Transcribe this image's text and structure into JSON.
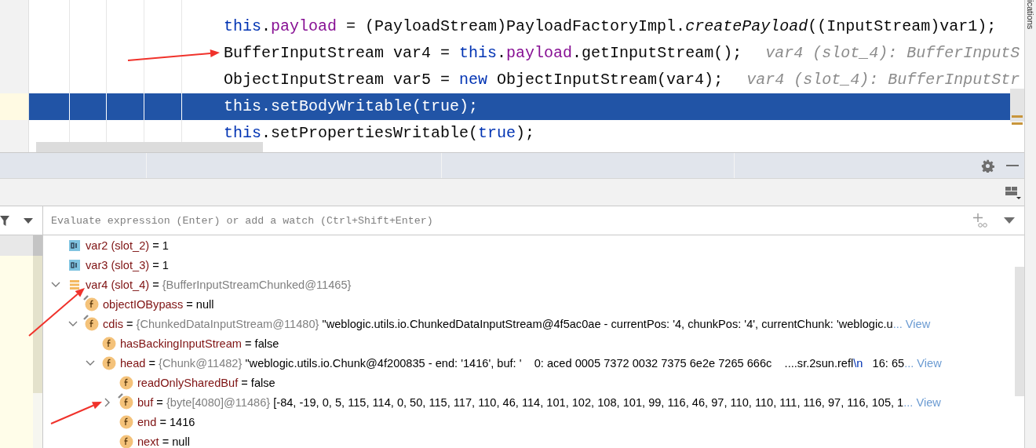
{
  "editor": {
    "lines": [
      {
        "current": false,
        "segments": [
          {
            "text": "this",
            "kind": "keyword"
          },
          {
            "text": ".",
            "kind": "plain"
          },
          {
            "text": "payload",
            "kind": "field"
          },
          {
            "text": " = (PayloadStream)PayloadFactoryImpl.",
            "kind": "plain"
          },
          {
            "text": "createPayload",
            "kind": "static"
          },
          {
            "text": "((InputStream)var1);",
            "kind": "plain"
          }
        ]
      },
      {
        "current": false,
        "segments": [
          {
            "text": "BufferInputStream var4 = ",
            "kind": "plain"
          },
          {
            "text": "this",
            "kind": "keyword"
          },
          {
            "text": ".",
            "kind": "plain"
          },
          {
            "text": "payload",
            "kind": "field"
          },
          {
            "text": ".getInputStream();",
            "kind": "plain"
          },
          {
            "text": "var4 (slot_4): BufferInputS",
            "kind": "hint"
          }
        ]
      },
      {
        "current": false,
        "segments": [
          {
            "text": "ObjectInputStream var5 = ",
            "kind": "plain"
          },
          {
            "text": "new",
            "kind": "keyword"
          },
          {
            "text": " ObjectInputStream(var4);",
            "kind": "plain"
          },
          {
            "text": "var4 (slot_4): BufferInputStr",
            "kind": "hint"
          }
        ]
      },
      {
        "current": true,
        "segments": [
          {
            "text": "this",
            "kind": "keyword"
          },
          {
            "text": ".setBodyWritable(",
            "kind": "plain"
          },
          {
            "text": "true",
            "kind": "keyword"
          },
          {
            "text": ");",
            "kind": "plain"
          }
        ]
      },
      {
        "current": false,
        "segments": [
          {
            "text": "this",
            "kind": "keyword"
          },
          {
            "text": ".setPropertiesWritable(",
            "kind": "plain"
          },
          {
            "text": "true",
            "kind": "keyword"
          },
          {
            "text": ");",
            "kind": "plain"
          }
        ]
      }
    ]
  },
  "side_strip": {
    "label": "ications"
  },
  "debugger": {
    "expression": {
      "placeholder": "Evaluate expression (Enter) or add a watch (Ctrl+Shift+Enter)"
    },
    "variables": [
      {
        "kind": "primitive",
        "badge": false,
        "segments": [
          {
            "text": "var2 (slot_2)",
            "kind": "name"
          },
          {
            "text": " = ",
            "kind": "plain"
          },
          {
            "text": "1",
            "kind": "plain"
          }
        ]
      },
      {
        "kind": "primitive",
        "badge": false,
        "segments": [
          {
            "text": "var3 (slot_3)",
            "kind": "name"
          },
          {
            "text": " = ",
            "kind": "plain"
          },
          {
            "text": "1",
            "kind": "plain"
          }
        ]
      },
      {
        "kind": "object",
        "badge": false,
        "expanded": true,
        "segments": [
          {
            "text": "var4 (slot_4)",
            "kind": "name"
          },
          {
            "text": " = ",
            "kind": "plain"
          },
          {
            "text": "{BufferInputStreamChunked@11465}",
            "kind": "type"
          }
        ],
        "children": [
          {
            "kind": "field",
            "badge": true,
            "segments": [
              {
                "text": "objectIOBypass",
                "kind": "name"
              },
              {
                "text": " = ",
                "kind": "plain"
              },
              {
                "text": "null",
                "kind": "plain"
              }
            ]
          },
          {
            "kind": "field",
            "badge": true,
            "expanded": true,
            "link": "... View",
            "segments": [
              {
                "text": "cdis",
                "kind": "name"
              },
              {
                "text": " = ",
                "kind": "plain"
              },
              {
                "text": "{ChunkedDataInputStream@11480}",
                "kind": "type"
              },
              {
                "text": " \"weblogic.utils.io.ChunkedDataInputStream@4f5ac0ae - currentPos: '4, chunkPos: '4', currentChunk: 'weblogic.u",
                "kind": "plain"
              }
            ],
            "children": [
              {
                "kind": "field",
                "badge": false,
                "segments": [
                  {
                    "text": "hasBackingInputStream",
                    "kind": "name"
                  },
                  {
                    "text": " = ",
                    "kind": "plain"
                  },
                  {
                    "text": "false",
                    "kind": "plain"
                  }
                ]
              },
              {
                "kind": "field",
                "badge": false,
                "expanded": true,
                "link": "... View",
                "segments": [
                  {
                    "text": "head",
                    "kind": "name"
                  },
                  {
                    "text": " = ",
                    "kind": "plain"
                  },
                  {
                    "text": "{Chunk@11482}",
                    "kind": "type"
                  },
                  {
                    "text": " \"weblogic.utils.io.Chunk@4f200835 - end: '1416', buf: '    0: aced 0005 7372 0032 7375 6e2e 7265 666c    ....sr.2sun.refl",
                    "kind": "plain"
                  },
                  {
                    "text": "\\n",
                    "kind": "escape"
                  },
                  {
                    "text": "   16: 65",
                    "kind": "plain"
                  }
                ],
                "children": [
                  {
                    "kind": "field",
                    "badge": false,
                    "segments": [
                      {
                        "text": "readOnlySharedBuf",
                        "kind": "name"
                      },
                      {
                        "text": " = ",
                        "kind": "plain"
                      },
                      {
                        "text": "false",
                        "kind": "plain"
                      }
                    ]
                  },
                  {
                    "kind": "field",
                    "badge": true,
                    "expanded": false,
                    "link": "... View",
                    "segments": [
                      {
                        "text": "buf",
                        "kind": "name"
                      },
                      {
                        "text": " = ",
                        "kind": "plain"
                      },
                      {
                        "text": "{byte[4080]@11486}",
                        "kind": "type"
                      },
                      {
                        "text": " [-84, -19, 0, 5, 115, 114, 0, 50, 115, 117, 110, 46, 114, 101, 102, 108, 101, 99, 116, 46, 97, 110, 110, 111, 116, 97, 116, 105, 1",
                        "kind": "plain"
                      }
                    ]
                  },
                  {
                    "kind": "field",
                    "badge": false,
                    "segments": [
                      {
                        "text": "end",
                        "kind": "name"
                      },
                      {
                        "text": " = ",
                        "kind": "plain"
                      },
                      {
                        "text": "1416",
                        "kind": "plain"
                      }
                    ]
                  },
                  {
                    "kind": "field",
                    "badge": false,
                    "segments": [
                      {
                        "text": "next",
                        "kind": "name"
                      },
                      {
                        "text": " = ",
                        "kind": "plain"
                      },
                      {
                        "text": "null",
                        "kind": "plain"
                      }
                    ]
                  }
                ]
              }
            ]
          }
        ]
      }
    ]
  }
}
